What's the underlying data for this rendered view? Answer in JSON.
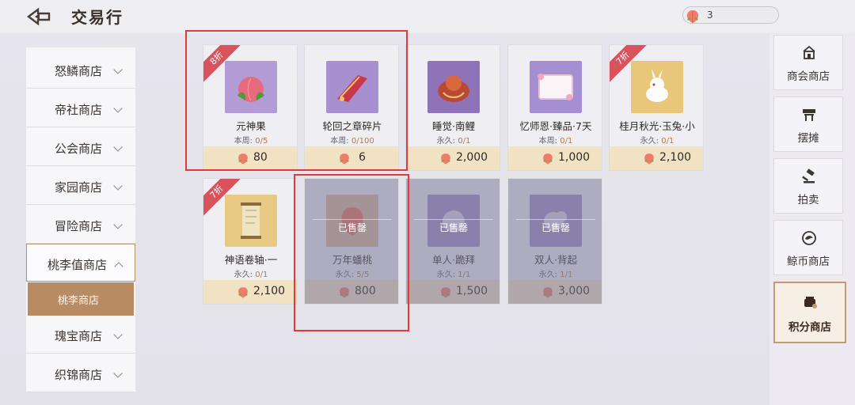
{
  "header": {
    "title": "交易行",
    "currency_value": "3"
  },
  "left_nav": {
    "items": [
      {
        "label": "怒鳞商店"
      },
      {
        "label": "帝社商店"
      },
      {
        "label": "公会商店"
      },
      {
        "label": "家园商店"
      },
      {
        "label": "冒险商店"
      },
      {
        "label": "桃李值商店",
        "active": true
      },
      {
        "label": "瑰宝商店"
      },
      {
        "label": "织锦商店"
      }
    ],
    "subitem": "桃李商店"
  },
  "cards": [
    {
      "name": "元神果",
      "limit_prefix": "本周:",
      "limit": "0/5",
      "price": "80",
      "badge": "8折",
      "icon": "spirit-fruit-icon",
      "bg": "#b39bd6"
    },
    {
      "name": "轮回之章碎片",
      "limit_prefix": "本周:",
      "limit": "0/100",
      "price": "6",
      "icon": "reincarnation-fragment-icon",
      "bg": "#a88fcf"
    },
    {
      "name": "睡觉·南鲤",
      "limit_prefix": "永久:",
      "limit": "0/1",
      "price": "2,000",
      "icon": "sleep-nanli-icon",
      "bg": "#8f73b8"
    },
    {
      "name": "忆师恩·臻品·7天",
      "limit_prefix": "本周:",
      "limit": "0/1",
      "price": "1,000",
      "icon": "frame-icon",
      "bg": "#a58ed2"
    },
    {
      "name": "桂月秋光·玉兔·小",
      "limit_prefix": "永久:",
      "limit": "0/1",
      "price": "2,100",
      "badge": "7折",
      "icon": "jade-rabbit-icon",
      "bg": "#e8c77a"
    },
    {
      "name": "神语卷轴·一",
      "limit_prefix": "永久:",
      "limit": "0/1",
      "price": "2,100",
      "badge": "7折",
      "icon": "scroll-icon",
      "bg": "#e7c983"
    },
    {
      "name": "万年蟠桃",
      "limit_prefix": "永久:",
      "limit": "5/5",
      "price": "800",
      "sold": "已售罄",
      "icon": "peach-icon",
      "bg": "#d9b79a"
    },
    {
      "name": "单人·跪拜",
      "limit_prefix": "永久:",
      "limit": "1/1",
      "price": "1,500",
      "sold": "已售罄",
      "icon": "kneel-icon",
      "bg": "#9d8dc6"
    },
    {
      "name": "双人·背起",
      "limit_prefix": "永久:",
      "limit": "1/1",
      "price": "3,000",
      "sold": "已售罄",
      "icon": "carry-icon",
      "bg": "#9d8dc6"
    }
  ],
  "right_nav": [
    {
      "label": "商会商店",
      "icon": "merchant-icon"
    },
    {
      "label": "摆摊",
      "icon": "stall-icon"
    },
    {
      "label": "拍卖",
      "icon": "gavel-icon"
    },
    {
      "label": "鲸币商店",
      "icon": "whale-coin-icon"
    },
    {
      "label": "积分商店",
      "icon": "points-shop-icon",
      "active": true
    }
  ],
  "colors": {
    "highlight": "#e23a3a",
    "badge": "#d8535c",
    "price_bar": "#f1e2c4",
    "active_accent": "#b98b63"
  }
}
